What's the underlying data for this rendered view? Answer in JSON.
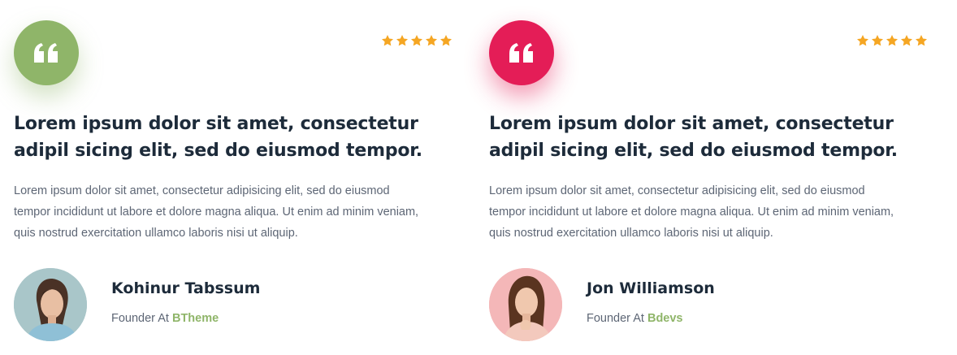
{
  "colors": {
    "green_accent": "#8fb569",
    "pink_accent": "#e41d57",
    "star": "#f5a623",
    "heading": "#1d2b3a",
    "text": "#5d6675"
  },
  "testimonials": [
    {
      "quote_icon": "quote-icon",
      "rating": 5,
      "headline": "Lorem ipsum dolor sit amet, consectetur adipil sicing elit, sed do eiusmod tempor.",
      "body": "Lorem ipsum dolor sit amet, consectetur adipisicing elit, sed do eiusmod tempor incididunt ut labore et dolore magna aliqua. Ut enim ad minim veniam, quis nostrud exercitation ullamco laboris nisi ut aliquip.",
      "author": {
        "name": "Kohinur Tabssum",
        "role_prefix": "Founder At",
        "company": "BTheme"
      }
    },
    {
      "quote_icon": "quote-icon",
      "rating": 5,
      "headline": "Lorem ipsum dolor sit amet, consectetur adipil sicing elit, sed do eiusmod tempor.",
      "body": "Lorem ipsum dolor sit amet, consectetur adipisicing elit, sed do eiusmod tempor incididunt ut labore et dolore magna aliqua. Ut enim ad minim veniam, quis nostrud exercitation ullamco laboris nisi ut aliquip.",
      "author": {
        "name": "Jon Williamson",
        "role_prefix": "Founder At",
        "company": "Bdevs"
      }
    }
  ]
}
